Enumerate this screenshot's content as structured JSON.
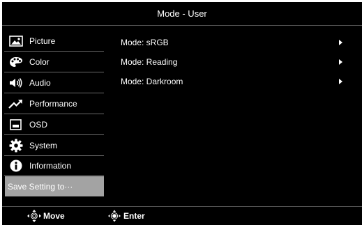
{
  "header": {
    "title": "Mode - User"
  },
  "sidebar": {
    "items": [
      {
        "label": "Picture",
        "icon": "picture-icon"
      },
      {
        "label": "Color",
        "icon": "palette-icon"
      },
      {
        "label": "Audio",
        "icon": "speaker-icon"
      },
      {
        "label": "Performance",
        "icon": "trend-arrow-icon"
      },
      {
        "label": "OSD",
        "icon": "osd-window-icon"
      },
      {
        "label": "System",
        "icon": "gear-icon"
      },
      {
        "label": "Information",
        "icon": "info-icon"
      }
    ],
    "save_label": "Save Setting to···"
  },
  "modes": [
    {
      "label": "Mode: sRGB"
    },
    {
      "label": "Mode: Reading"
    },
    {
      "label": "Mode: Darkroom"
    }
  ],
  "footer": {
    "move_label": "Move",
    "enter_label": "Enter"
  },
  "colors": {
    "background": "#000000",
    "text": "#ffffff",
    "selected": "#a3a3a3",
    "separator": "#6a6a6a"
  }
}
